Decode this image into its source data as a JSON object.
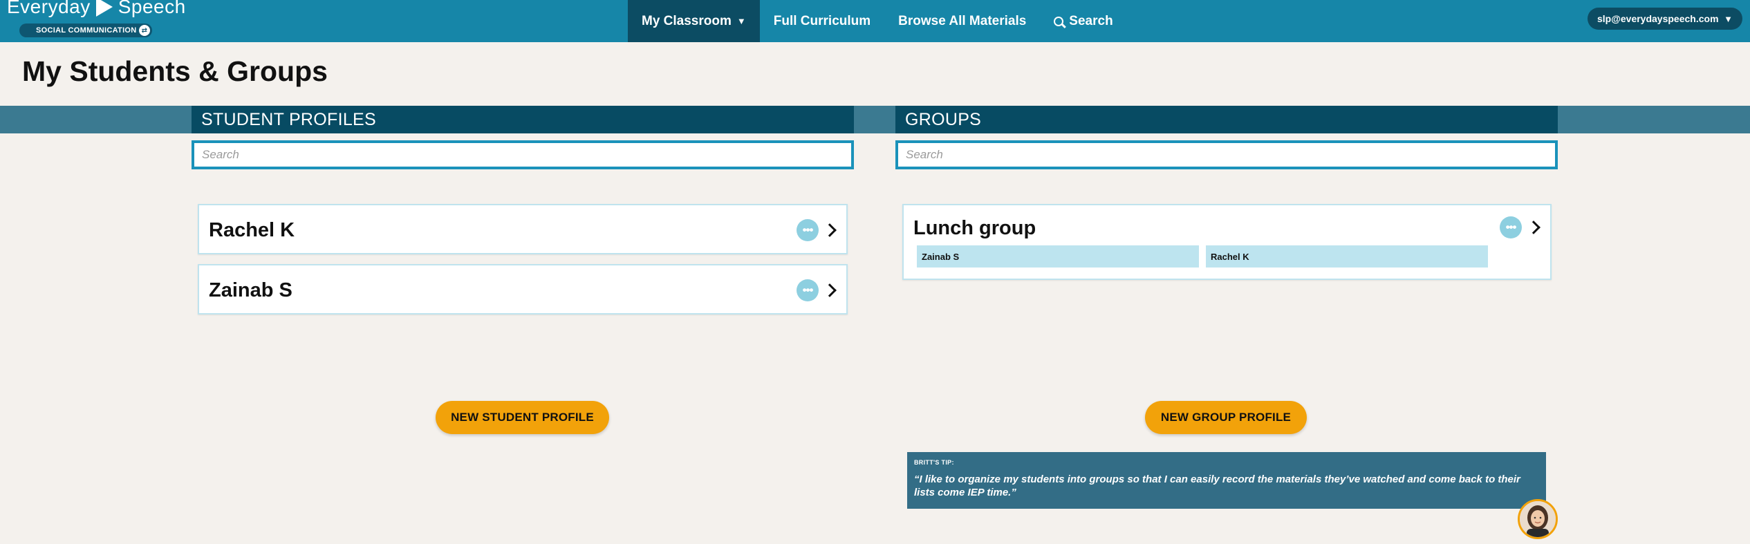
{
  "app": {
    "brand_left": "Everyday",
    "brand_right": "Speech",
    "program": "SOCIAL COMMUNICATION",
    "program_switch_icon": "swap-icon"
  },
  "nav": {
    "items": [
      {
        "label": "My Classroom",
        "active": true,
        "icon": "chevron-down-icon"
      },
      {
        "label": "Full Curriculum",
        "active": false
      },
      {
        "label": "Browse All Materials",
        "active": false
      },
      {
        "label": "Search",
        "active": false,
        "icon": "search-icon"
      }
    ]
  },
  "account": {
    "email": "slp@everydayspeech.com",
    "icon": "chevron-down-icon"
  },
  "page": {
    "title": "My Students & Groups"
  },
  "students": {
    "heading": "STUDENT PROFILES",
    "search_placeholder": "Search",
    "items": [
      {
        "name": "Rachel K"
      },
      {
        "name": "Zainab S"
      }
    ],
    "new_button": "NEW STUDENT PROFILE"
  },
  "groups": {
    "heading": "GROUPS",
    "search_placeholder": "Search",
    "items": [
      {
        "name": "Lunch group",
        "members": [
          "Zainab S",
          "Rachel K"
        ]
      }
    ],
    "new_button": "NEW GROUP PROFILE"
  },
  "tip": {
    "label": "BRITT'S TIP:",
    "text": "“I like to organize my students into groups so that I can easily record the materials they’ve watched and come back to their lists come IEP time.”"
  },
  "colors": {
    "nav_bg": "#1686a8",
    "nav_active": "#0c4c63",
    "header_band": "#3b7a91",
    "header_dark": "#074b63",
    "accent_orange": "#f2a20a",
    "chip_bg": "#bde4ef",
    "page_bg": "#f4f1ed"
  }
}
